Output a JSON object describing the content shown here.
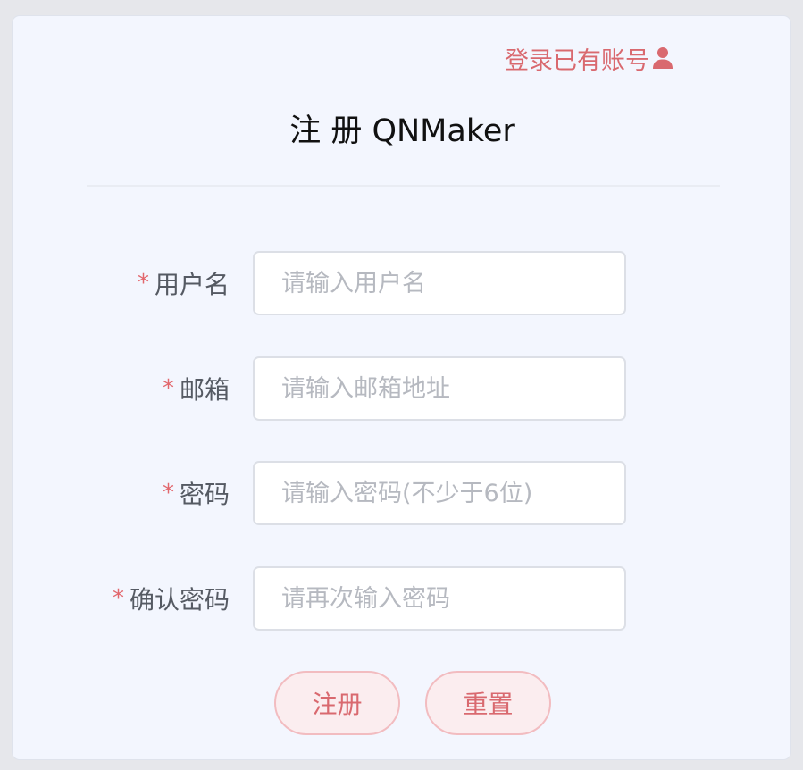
{
  "header": {
    "login_link": "登录已有账号",
    "title": "注 册 QNMaker"
  },
  "form": {
    "required_mark": "*",
    "fields": [
      {
        "label": "用户名",
        "placeholder": "请输入用户名",
        "value": ""
      },
      {
        "label": "邮箱",
        "placeholder": "请输入邮箱地址",
        "value": ""
      },
      {
        "label": "密码",
        "placeholder": "请输入密码(不少于6位)",
        "value": ""
      },
      {
        "label": "确认密码",
        "placeholder": "请再次输入密码",
        "value": ""
      }
    ]
  },
  "buttons": {
    "register_label": "注册",
    "reset_label": "重置"
  },
  "icons": {
    "login_link_icon": "user-icon"
  },
  "colors": {
    "accent": "#d9696f",
    "required": "#e2676d",
    "card_background": "#f3f6fe",
    "button_background": "#fbedef"
  }
}
